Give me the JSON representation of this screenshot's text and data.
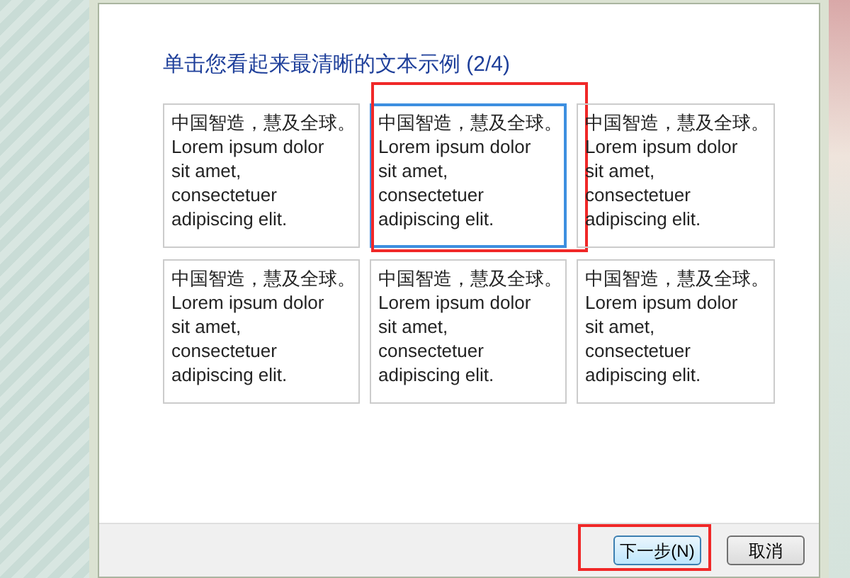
{
  "heading": "单击您看起来最清晰的文本示例 (2/4)",
  "samples": [
    {
      "text": "中国智造，慧及全球。\nLorem ipsum dolor\nsit amet,\nconsectetuer\nadipiscing elit.",
      "selected": false,
      "annotated": false
    },
    {
      "text": "中国智造，慧及全球。\nLorem ipsum dolor\nsit amet,\nconsectetuer\nadipiscing elit.",
      "selected": true,
      "annotated": true
    },
    {
      "text": "中国智造，慧及全球。\nLorem ipsum dolor\nsit amet,\nconsectetuer\nadipiscing elit.",
      "selected": false,
      "annotated": false
    },
    {
      "text": "中国智造，慧及全球。\nLorem ipsum dolor\nsit amet,\nconsectetuer\nadipiscing elit.",
      "selected": false,
      "annotated": false
    },
    {
      "text": "中国智造，慧及全球。\nLorem ipsum dolor\nsit amet,\nconsectetuer\nadipiscing elit.",
      "selected": false,
      "annotated": false
    },
    {
      "text": "中国智造，慧及全球。\nLorem ipsum dolor\nsit amet,\nconsectetuer\nadipiscing elit.",
      "selected": false,
      "annotated": false
    }
  ],
  "buttons": [
    {
      "label": "下一步(N)",
      "default": true,
      "annotated": true
    },
    {
      "label": "取消",
      "default": false,
      "annotated": false
    }
  ]
}
